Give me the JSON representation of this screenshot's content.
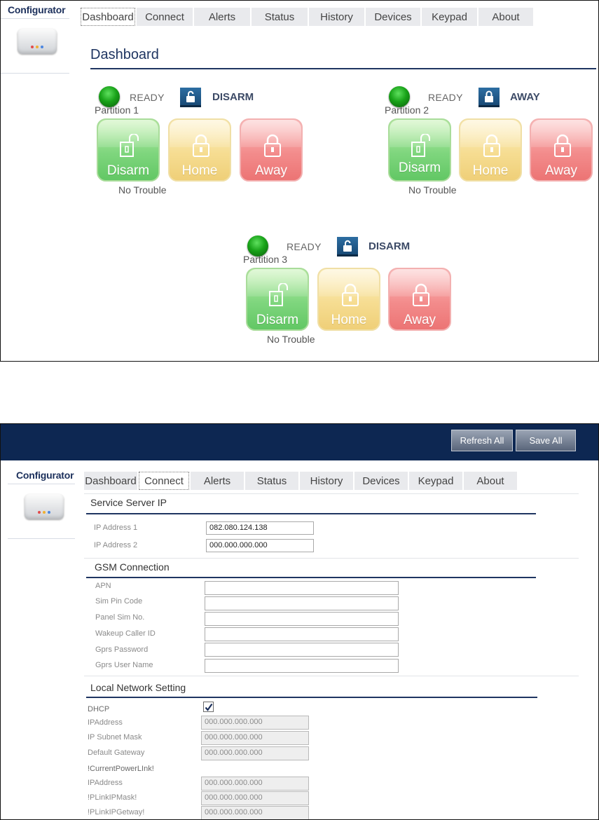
{
  "colors": {
    "navy": "#0d2752",
    "accent": "#1f3561",
    "disarm": "#7fd67e",
    "home": "#f6dd92",
    "away": "#f38c8c",
    "ready_led": "#19a319"
  },
  "dashboard_window": {
    "sidebar": {
      "brand": "Configurator",
      "device_icon": "panel-device-icon"
    },
    "tabs": [
      {
        "label": "Dashboard",
        "active": true
      },
      {
        "label": "Connect",
        "active": false
      },
      {
        "label": "Alerts",
        "active": false
      },
      {
        "label": "Status",
        "active": false
      },
      {
        "label": "History",
        "active": false
      },
      {
        "label": "Devices",
        "active": false
      },
      {
        "label": "Keypad",
        "active": false
      },
      {
        "label": "About",
        "active": false
      }
    ],
    "title": "Dashboard",
    "partitions": [
      {
        "name": "Partition 1",
        "ready": "READY",
        "state": "DISARM",
        "trouble": "No Trouble",
        "buttons": {
          "disarm": "Disarm",
          "home": "Home",
          "away": "Away"
        }
      },
      {
        "name": "Partition 2",
        "ready": "READY",
        "state": "AWAY",
        "trouble": "No Trouble",
        "buttons": {
          "disarm": "Disarm",
          "home": "Home",
          "away": "Away"
        }
      },
      {
        "name": "Partition 3",
        "ready": "READY",
        "state": "DISARM",
        "trouble": "No Trouble",
        "buttons": {
          "disarm": "Disarm",
          "home": "Home",
          "away": "Away"
        }
      }
    ]
  },
  "connect_window": {
    "header_buttons": {
      "refresh": "Refresh All",
      "save": "Save All"
    },
    "sidebar": {
      "brand": "Configurator",
      "device_icon": "panel-device-icon"
    },
    "tabs": [
      {
        "label": "Dashboard",
        "active": false
      },
      {
        "label": "Connect",
        "active": true
      },
      {
        "label": "Alerts",
        "active": false
      },
      {
        "label": "Status",
        "active": false
      },
      {
        "label": "History",
        "active": false
      },
      {
        "label": "Devices",
        "active": false
      },
      {
        "label": "Keypad",
        "active": false
      },
      {
        "label": "About",
        "active": false
      }
    ],
    "service_server": {
      "title": "Service Server IP",
      "fields": [
        {
          "label": "IP Address 1",
          "value": "082.080.124.138"
        },
        {
          "label": "IP Address 2",
          "value": "000.000.000.000"
        }
      ]
    },
    "gsm": {
      "title": "GSM Connection",
      "fields": [
        {
          "label": "APN",
          "value": ""
        },
        {
          "label": "Sim Pin Code",
          "value": ""
        },
        {
          "label": "Panel Sim No.",
          "value": ""
        },
        {
          "label": "Wakeup Caller ID",
          "value": ""
        },
        {
          "label": "Gprs Password",
          "value": ""
        },
        {
          "label": "Gprs User Name",
          "value": ""
        }
      ]
    },
    "local_network": {
      "title": "Local Network Setting",
      "dhcp_label": "DHCP",
      "dhcp_checked": true,
      "fields": [
        {
          "label": "IPAddress",
          "value": "000.000.000.000"
        },
        {
          "label": "IP Subnet Mask",
          "value": "000.000.000.000"
        },
        {
          "label": "Default Gateway",
          "value": "000.000.000.000"
        }
      ],
      "current_label": "!CurrentPowerLInk!",
      "plink_fields": [
        {
          "label": "IPAddress",
          "value": "000.000.000.000"
        },
        {
          "label": "!PLinkIPMask!",
          "value": "000.000.000.000"
        },
        {
          "label": "!PLinkIPGetway!",
          "value": "000.000.000.000"
        }
      ]
    }
  }
}
